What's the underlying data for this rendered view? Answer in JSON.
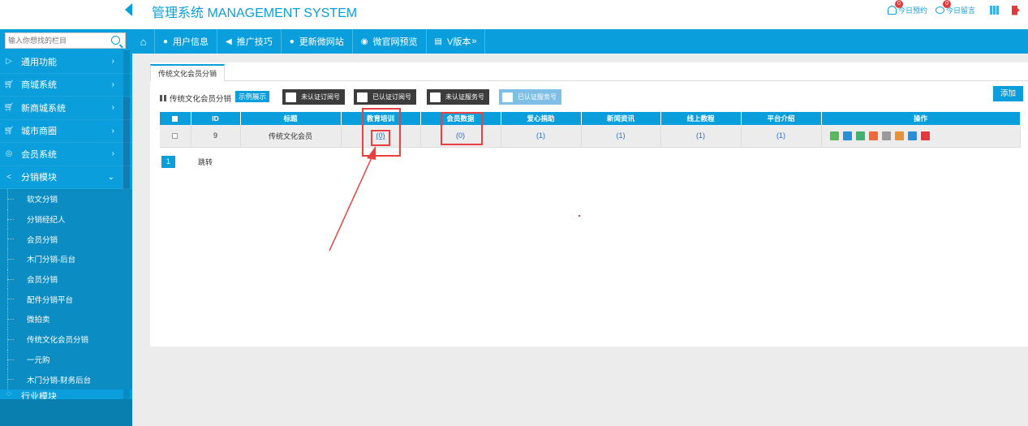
{
  "colors": {
    "accent": "#0a9fdc",
    "annotation": "#e8413f",
    "danger": "#e4393c"
  },
  "header": {
    "title": "管理系统 MANAGEMENT SYSTEM",
    "actions": [
      {
        "label": "今日预约",
        "badge": "0",
        "icon": "person-icon"
      },
      {
        "label": "今日留言",
        "badge": "0",
        "icon": "chat-icon"
      }
    ]
  },
  "sidebar": {
    "search_placeholder": "输入你想找的栏目",
    "items": [
      {
        "label": "通用功能",
        "icon": "play-icon"
      },
      {
        "label": "商城系统",
        "icon": "cart-icon"
      },
      {
        "label": "新商城系统",
        "icon": "cart-icon"
      },
      {
        "label": "城市商圈",
        "icon": "cart-icon"
      },
      {
        "label": "会员系统",
        "icon": "vip-icon"
      },
      {
        "label": "分销模块",
        "icon": "share-icon"
      }
    ],
    "sub_items": [
      "软文分销",
      "分销经纪人",
      "会员分销",
      "木门分销-后台",
      "会员分销",
      "配件分销平台",
      "微拍卖",
      "传统文化会员分销",
      "一元购",
      "木门分销-财务后台"
    ],
    "cut_item": "行业模块"
  },
  "topnav": {
    "items": [
      {
        "label": "用户信息",
        "icon": "user-icon"
      },
      {
        "label": "推广技巧",
        "icon": "megaphone-icon"
      },
      {
        "label": "更新微网站",
        "icon": "globe-icon"
      },
      {
        "label": "微官网预览",
        "icon": "eye-icon"
      },
      {
        "label": "V版本",
        "icon": "layers-icon"
      }
    ]
  },
  "main": {
    "tab": "传统文化会员分销",
    "page_title": "传统文化会员分销",
    "demo_button": "示例展示",
    "filter_buttons": [
      "未认证订阅号",
      "已认证订阅号",
      "未认证服务号",
      "已认证服务号"
    ],
    "add_button": "添加",
    "table": {
      "columns": [
        "ID",
        "标题",
        "教育培训",
        "会员数据",
        "爱心捐助",
        "新闻资讯",
        "线上教程",
        "平台介绍",
        "操作"
      ],
      "rows": [
        {
          "id": "9",
          "title": "传统文化会员",
          "edu": "(0)",
          "member": "(0)",
          "love": "(1)",
          "news": "(1)",
          "course": "(1)",
          "intro": "(1)"
        }
      ]
    },
    "pager": {
      "current": "1",
      "go_label": "跳转"
    }
  }
}
